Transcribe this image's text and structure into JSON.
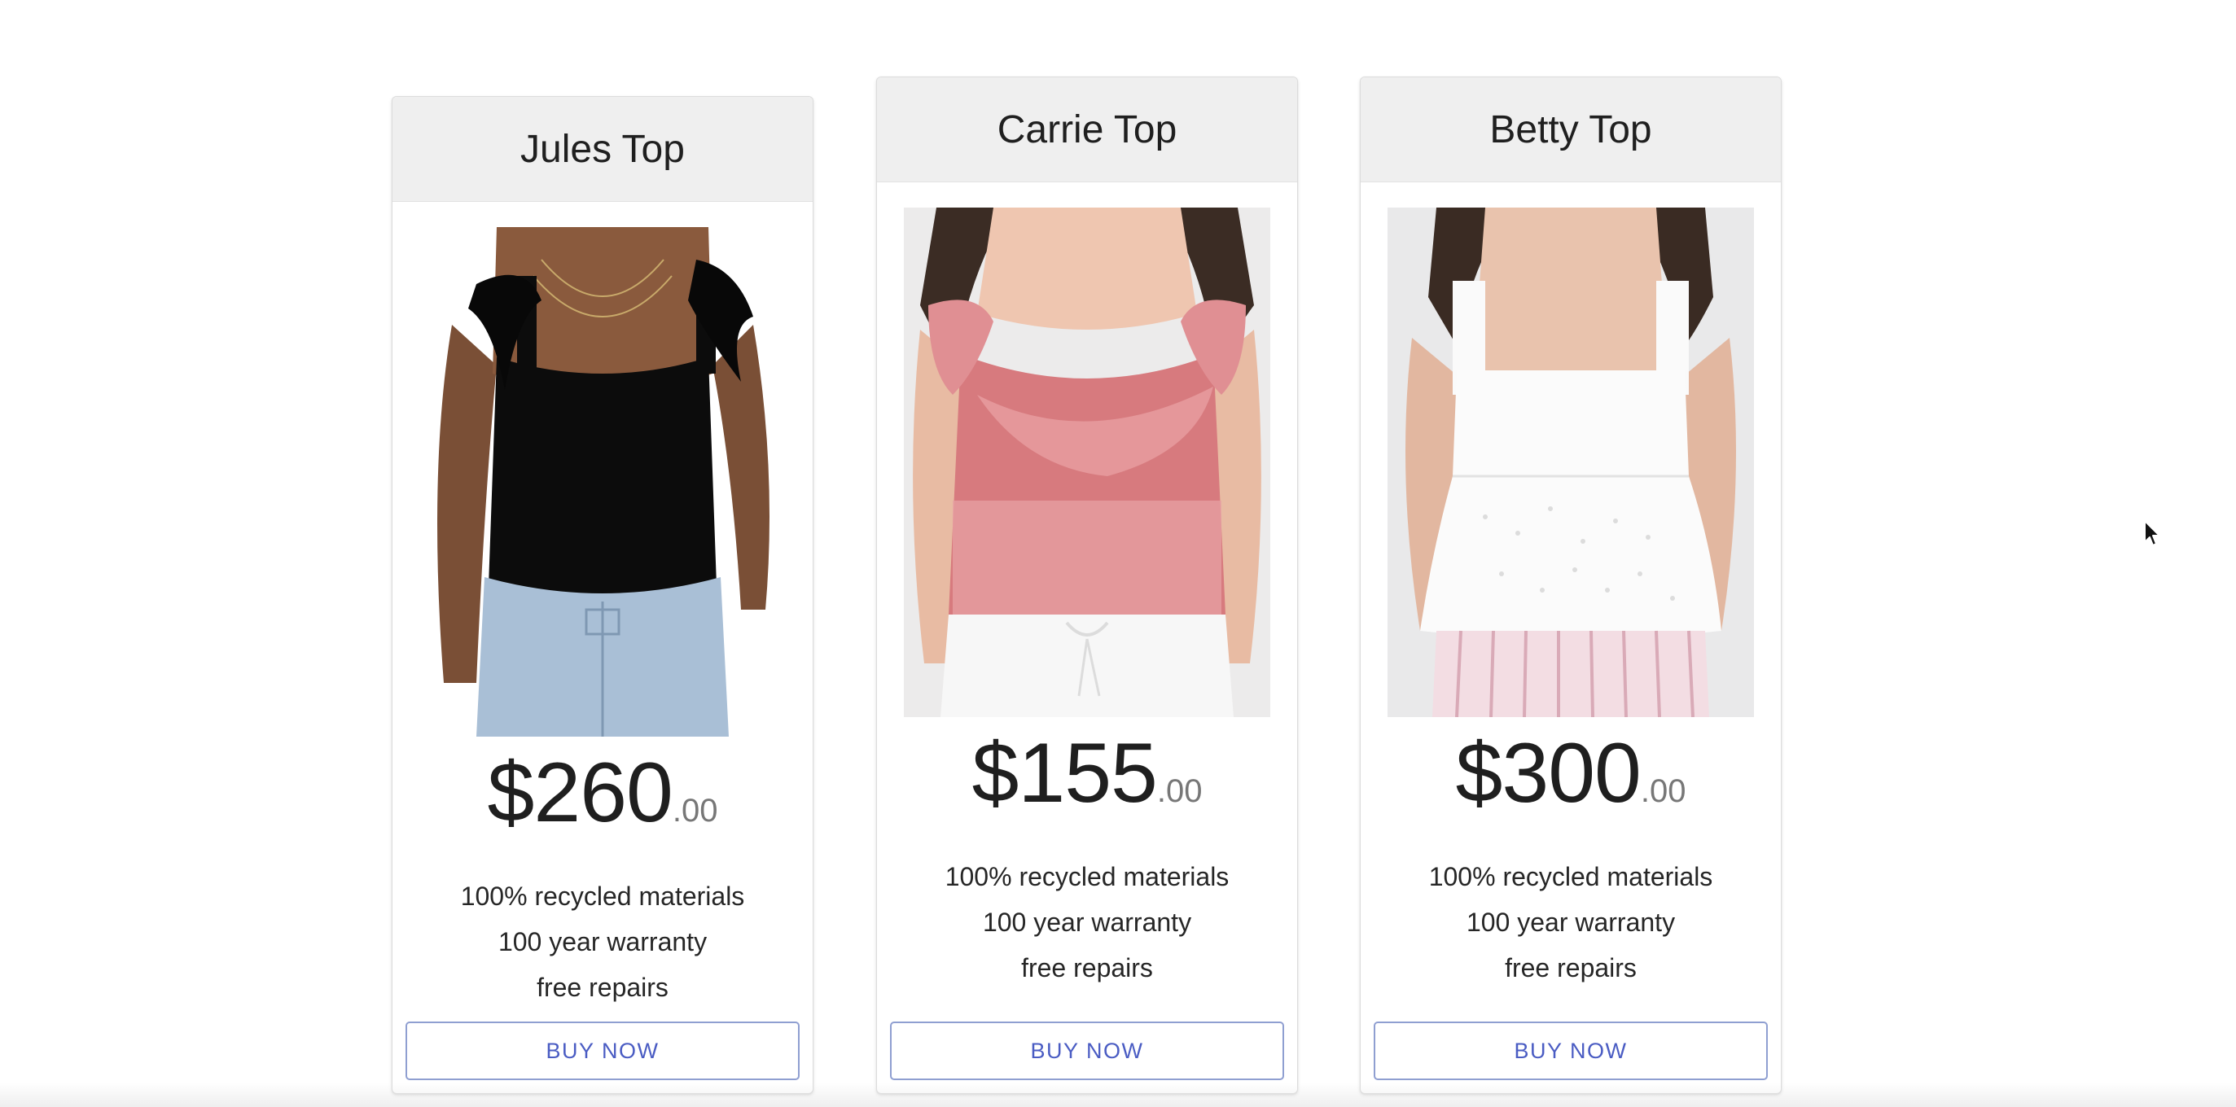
{
  "products": [
    {
      "name": "Jules Top",
      "price_main": "$260",
      "price_cents": ".00",
      "features": [
        "100% recycled materials",
        "100 year warranty",
        "free repairs"
      ],
      "button_label": "BUY NOW",
      "image": "black-tie-strap-tank-top-photo"
    },
    {
      "name": "Carrie Top",
      "price_main": "$155",
      "price_cents": ".00",
      "features": [
        "100% recycled materials",
        "100 year warranty",
        "free repairs"
      ],
      "button_label": "BUY NOW",
      "image": "pink-ruffle-sheer-top-photo"
    },
    {
      "name": "Betty Top",
      "price_main": "$300",
      "price_cents": ".00",
      "features": [
        "100% recycled materials",
        "100 year warranty",
        "free repairs"
      ],
      "button_label": "BUY NOW",
      "image": "white-eyelet-square-neck-top-photo"
    }
  ],
  "colors": {
    "header_bg": "#efefef",
    "button_text": "#4a5cc3",
    "button_border": "#8f9fd1",
    "cents_text": "#777777"
  },
  "icons": {
    "cursor": "mouse-pointer-icon"
  }
}
